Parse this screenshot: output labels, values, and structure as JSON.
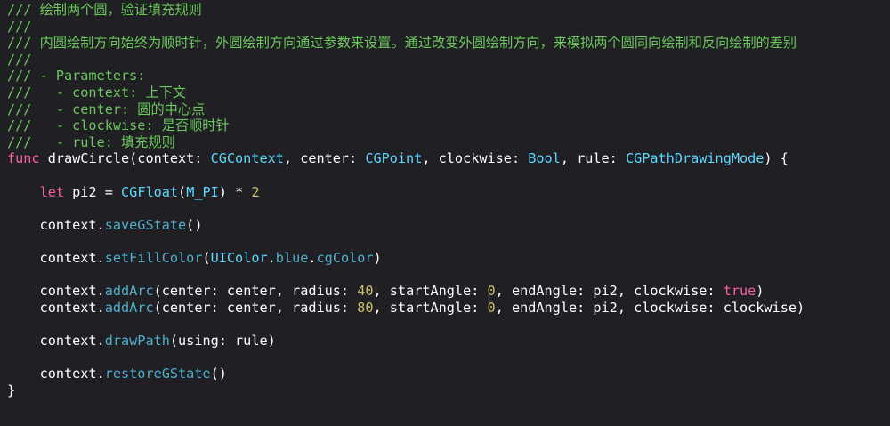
{
  "editor": {
    "background": "#1f1f24",
    "colors": {
      "comment": "#6bc85c",
      "keyword": "#fc5fa3",
      "type": "#5dd8ff",
      "method": "#4eb0cc",
      "number": "#d0bf69",
      "plain": "#ffffff"
    },
    "lines": [
      [
        {
          "t": "comment",
          "v": "/// 绘制两个圆，验证填充规则"
        }
      ],
      [
        {
          "t": "comment",
          "v": "///"
        }
      ],
      [
        {
          "t": "comment",
          "v": "/// 内圆绘制方向始终为顺时针，外圆绘制方向通过参数来设置。通过改变外圆绘制方向，来模拟两个圆同向绘制和反向绘制的差别"
        }
      ],
      [
        {
          "t": "comment",
          "v": "///"
        }
      ],
      [
        {
          "t": "comment",
          "v": "/// - Parameters:"
        }
      ],
      [
        {
          "t": "comment",
          "v": "///   - context: 上下文"
        }
      ],
      [
        {
          "t": "comment",
          "v": "///   - center: 圆的中心点"
        }
      ],
      [
        {
          "t": "comment",
          "v": "///   - clockwise: 是否顺时针"
        }
      ],
      [
        {
          "t": "comment",
          "v": "///   - rule: 填充规则"
        }
      ],
      [
        {
          "t": "keyword",
          "v": "func"
        },
        {
          "t": "plain",
          "v": " drawCircle(context: "
        },
        {
          "t": "type",
          "v": "CGContext"
        },
        {
          "t": "plain",
          "v": ", center: "
        },
        {
          "t": "type",
          "v": "CGPoint"
        },
        {
          "t": "plain",
          "v": ", clockwise: "
        },
        {
          "t": "type",
          "v": "Bool"
        },
        {
          "t": "plain",
          "v": ", rule: "
        },
        {
          "t": "type",
          "v": "CGPathDrawingMode"
        },
        {
          "t": "plain",
          "v": ") {"
        }
      ],
      [],
      [
        {
          "t": "plain",
          "v": "    "
        },
        {
          "t": "keyword",
          "v": "let"
        },
        {
          "t": "plain",
          "v": " pi2 = "
        },
        {
          "t": "type",
          "v": "CGFloat"
        },
        {
          "t": "plain",
          "v": "("
        },
        {
          "t": "type",
          "v": "M_PI"
        },
        {
          "t": "plain",
          "v": ") * "
        },
        {
          "t": "number",
          "v": "2"
        }
      ],
      [],
      [
        {
          "t": "plain",
          "v": "    context."
        },
        {
          "t": "method",
          "v": "saveGState"
        },
        {
          "t": "plain",
          "v": "()"
        }
      ],
      [],
      [
        {
          "t": "plain",
          "v": "    context."
        },
        {
          "t": "method",
          "v": "setFillColor"
        },
        {
          "t": "plain",
          "v": "("
        },
        {
          "t": "type",
          "v": "UIColor"
        },
        {
          "t": "plain",
          "v": "."
        },
        {
          "t": "method",
          "v": "blue"
        },
        {
          "t": "plain",
          "v": "."
        },
        {
          "t": "method",
          "v": "cgColor"
        },
        {
          "t": "plain",
          "v": ")"
        }
      ],
      [],
      [
        {
          "t": "plain",
          "v": "    context."
        },
        {
          "t": "method",
          "v": "addArc"
        },
        {
          "t": "plain",
          "v": "(center: center, radius: "
        },
        {
          "t": "number",
          "v": "40"
        },
        {
          "t": "plain",
          "v": ", startAngle: "
        },
        {
          "t": "number",
          "v": "0"
        },
        {
          "t": "plain",
          "v": ", endAngle: pi2, clockwise: "
        },
        {
          "t": "keyword",
          "v": "true"
        },
        {
          "t": "plain",
          "v": ")"
        }
      ],
      [
        {
          "t": "plain",
          "v": "    context."
        },
        {
          "t": "method",
          "v": "addArc"
        },
        {
          "t": "plain",
          "v": "(center: center, radius: "
        },
        {
          "t": "number",
          "v": "80"
        },
        {
          "t": "plain",
          "v": ", startAngle: "
        },
        {
          "t": "number",
          "v": "0"
        },
        {
          "t": "plain",
          "v": ", endAngle: pi2, clockwise: clockwise)"
        }
      ],
      [],
      [
        {
          "t": "plain",
          "v": "    context."
        },
        {
          "t": "method",
          "v": "drawPath"
        },
        {
          "t": "plain",
          "v": "(using: rule)"
        }
      ],
      [],
      [
        {
          "t": "plain",
          "v": "    context."
        },
        {
          "t": "method",
          "v": "restoreGState"
        },
        {
          "t": "plain",
          "v": "()"
        }
      ],
      [
        {
          "t": "plain",
          "v": "}"
        }
      ]
    ]
  }
}
